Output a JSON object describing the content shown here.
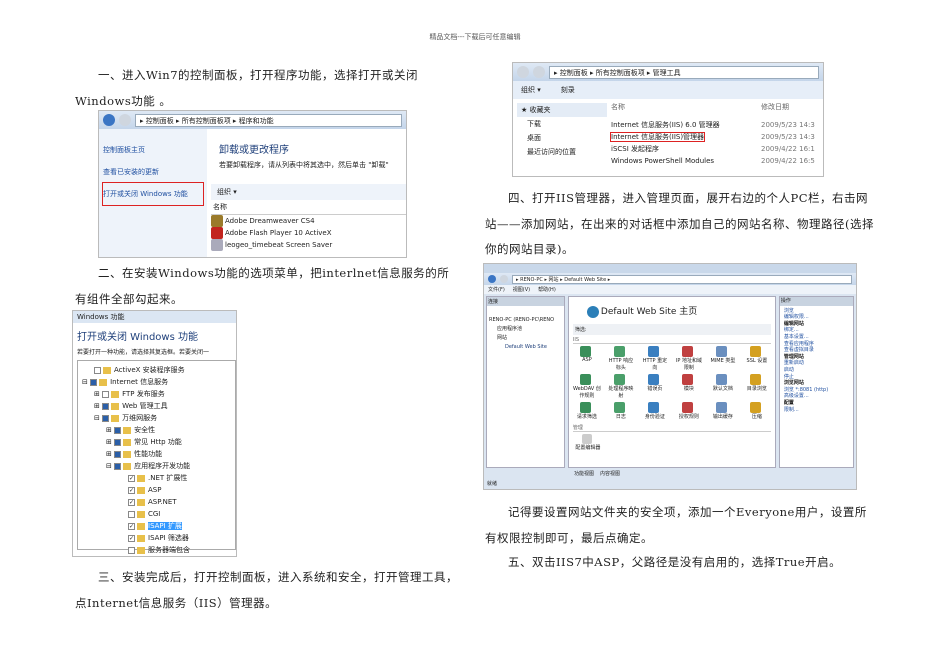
{
  "header": "精品文档---下载后可任意编辑",
  "paragraphs": {
    "p1": "一、进入Win7的控制面板，打开程序功能，选择打开或关闭Windows功能 。",
    "p2": "二、在安装Windows功能的选项菜单，把interlnet信息服务的所有组件全部勾起来。",
    "p3": "三、安装完成后，打开控制面板，进入系统和安全，打开管理工具，点Internet信息服务（IIS）管理器。",
    "p4": "四、打开IIS管理器，进入管理页面，展开右边的个人PC栏，右击网站——添加网站，在出来的对话框中添加自己的网站名称、物理路径(选择你的网站目录)。",
    "p5": "记得要设置网站文件夹的安全项，添加一个Everyone用户，设置所有权限控制即可，最后点确定。",
    "p6": "五、双击IIS7中ASP，父路径是没有启用的，选择True开启。"
  },
  "shot1": {
    "address": "▸ 控制面板 ▸ 所有控制面板项 ▸ 程序和功能",
    "links": [
      "控制面板主页",
      "查看已安装的更新",
      "打开或关闭 Windows 功能"
    ],
    "title": "卸载或更改程序",
    "desc": "若要卸载程序，请从列表中将其选中，然后单击 \"卸载\"",
    "organize": "组织 ▾",
    "col": "名称",
    "programs": [
      "Adobe Dreamweaver CS4",
      "Adobe Flash Player 10 ActiveX",
      "leogeo_timebeat  Screen Saver"
    ]
  },
  "shot2": {
    "window": "Windows 功能",
    "title": "打开或关闭 Windows 功能",
    "desc": "若要打开一种功能，请选择其复选框。若要关闭一",
    "items": [
      "ActiveX 安装程序服务",
      "Internet 信息服务",
      "FTP 发布服务",
      "Web 管理工具",
      "万维网服务",
      "安全性",
      "常见 Http 功能",
      "性能功能",
      "应用程序开发功能",
      ".NET 扩展性",
      "ASP",
      "ASP.NET",
      "CGI",
      "ISAPI 扩展",
      "ISAPI 筛选器",
      "服务器端包含"
    ]
  },
  "shot3": {
    "address": "▸ 控制面板 ▸ 所有控制面板项 ▸ 管理工具",
    "toolbar": [
      "组织 ▾",
      "刻录"
    ],
    "nav": [
      "收藏夹",
      "下载",
      "桌面",
      "最近访问的位置"
    ],
    "col_name": "名称",
    "col_date": "修改日期",
    "files": [
      {
        "name": "Internet 信息服务(IIS) 6.0 管理器",
        "date": "2009/5/23 14:3"
      },
      {
        "name": "Internet 信息服务(IIS)管理器",
        "date": "2009/5/23 14:3"
      },
      {
        "name": "iSCSI 发起程序",
        "date": "2009/4/22 16:1"
      },
      {
        "name": "Windows PowerShell Modules",
        "date": "2009/4/22 16:5"
      }
    ]
  },
  "shot4": {
    "address": "▸ RENO-PC ▸ 网站 ▸ Default Web Site ▸",
    "menu": [
      "文件(F)",
      "视图(V)",
      "帮助(H)"
    ],
    "conn_title": "连接",
    "tree": [
      "RENO-PC (RENO-PC\\RENO",
      "应用程序池",
      "网站",
      "Default Web Site"
    ],
    "home": "Default Web Site 主页",
    "filter": "筛选:",
    "group": "IIS",
    "features": [
      "ASP",
      "HTTP 响应标头",
      "HTTP 重定向",
      "IP 地址和域限制",
      "MIME 类型",
      "SSL 设置",
      "WebDAV 创作规则",
      "处理程序映射",
      "错误页",
      "模块",
      "默认文档",
      "目录浏览",
      "请求筛选",
      "日志",
      "身份验证",
      "授权规则",
      "输出缓存",
      "压缩"
    ],
    "manage": "管理",
    "config": "配置编辑器",
    "views": [
      "功能视图",
      "内容视图"
    ],
    "actions_title": "操作",
    "actions": [
      "浏览",
      "编辑权限...",
      "编辑网站",
      "绑定...",
      "基本设置...",
      "查看应用程序",
      "查看虚拟目录",
      "管理网站",
      "重新启动",
      "启动",
      "停止",
      "浏览网站",
      "浏览 *:8081 (http)",
      "高级设置...",
      "配置",
      "限制..."
    ],
    "status": "就绪"
  }
}
